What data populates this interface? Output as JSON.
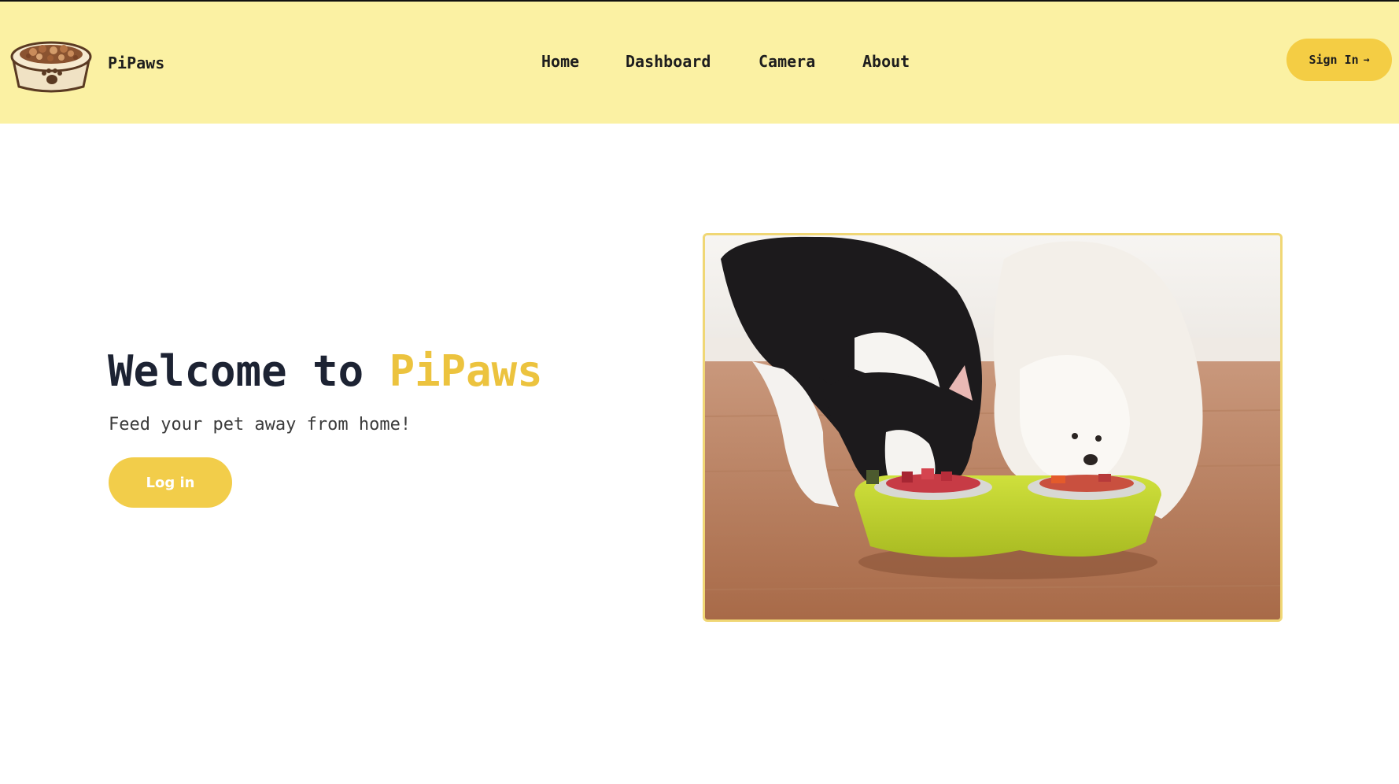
{
  "brand": {
    "name": "PiPaws",
    "logo_icon": "pet-food-bowl-icon"
  },
  "nav": {
    "items": [
      {
        "label": "Home"
      },
      {
        "label": "Dashboard"
      },
      {
        "label": "Camera"
      },
      {
        "label": "About"
      }
    ],
    "sign_in": {
      "label": "Sign In",
      "arrow": "→",
      "icon": "arrow-right-icon"
    }
  },
  "hero": {
    "title_prefix": "Welcome to",
    "title_accent": "PiPaws",
    "subtitle": "Feed your pet away from home!",
    "login_label": "Log in",
    "image_alt_icon": "cat-and-dog-eating-photo"
  },
  "colors": {
    "navbar_bg": "#fbf1a3",
    "accent": "#ecc33e",
    "button": "#f2cd4a",
    "title_dark": "#1d2333"
  }
}
